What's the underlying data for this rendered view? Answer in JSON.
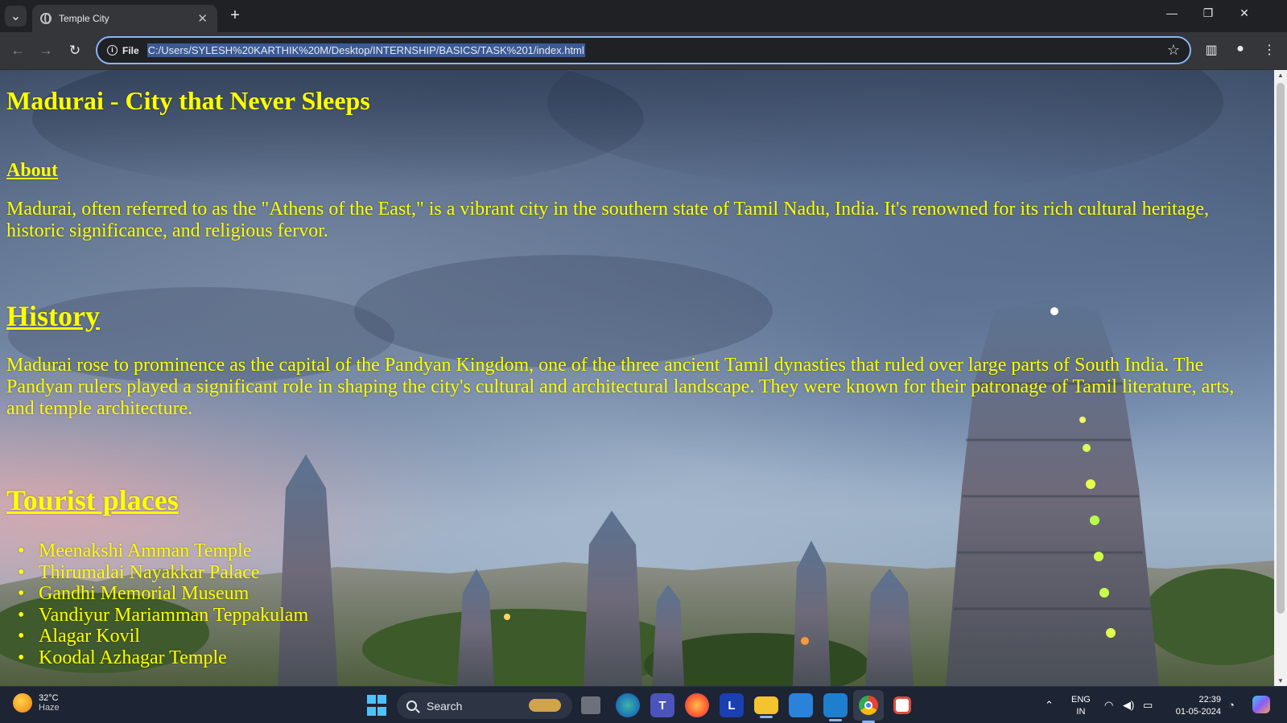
{
  "browser": {
    "tab_title": "Temple City",
    "new_tab": "+",
    "site_info": "File",
    "url": "C:/Users/SYLESH%20KARTHIK%20M/Desktop/INTERNSHIP/BASICS/TASK%201/index.html",
    "icons": {
      "tab_search": "chevron-down-icon",
      "tab_close": "close-icon",
      "back": "back-arrow-icon",
      "forward": "forward-arrow-icon",
      "reload": "reload-icon",
      "bookmark": "star-icon",
      "side_panel": "side-panel-icon",
      "profile": "profile-icon",
      "menu": "kebab-menu-icon"
    }
  },
  "page": {
    "title": "Madurai - City that Never Sleeps",
    "about_heading": "About",
    "about_text": "Madurai, often referred to as the \"Athens of the East,\" is a vibrant city in the southern state of Tamil Nadu, India. It's renowned for its rich cultural heritage, historic significance, and religious fervor.",
    "history_heading": "History",
    "history_text": "Madurai rose to prominence as the capital of the Pandyan Kingdom, one of the three ancient Tamil dynasties that ruled over large parts of South India. The Pandyan rulers played a significant role in shaping the city's cultural and architectural landscape. They were known for their patronage of Tamil literature, arts, and temple architecture.",
    "tourist_heading": "Tourist places",
    "places": [
      "Meenakshi Amman Temple",
      "Thirumalai Nayakkar Palace",
      "Gandhi Memorial Museum",
      "Vandiyur Mariamman Teppakulam",
      "Alagar Kovil",
      "Koodal Azhagar Temple"
    ],
    "text_color": "#ffff00"
  },
  "taskbar": {
    "weather_temp": "32°C",
    "weather_cond": "Haze",
    "search_label": "Search",
    "apps": [
      "start-icon",
      "copilot-icon",
      "task-view-icon",
      "edge-icon",
      "teams-icon",
      "firefox-icon",
      "l-app-icon",
      "file-explorer-icon",
      "store-icon",
      "vscode-icon",
      "chrome-icon",
      "snipping-icon"
    ],
    "lang_1": "ENG",
    "lang_2": "IN",
    "time": "22:39",
    "date": "01-05-2024",
    "teams_label": "T",
    "l_label": "L"
  }
}
